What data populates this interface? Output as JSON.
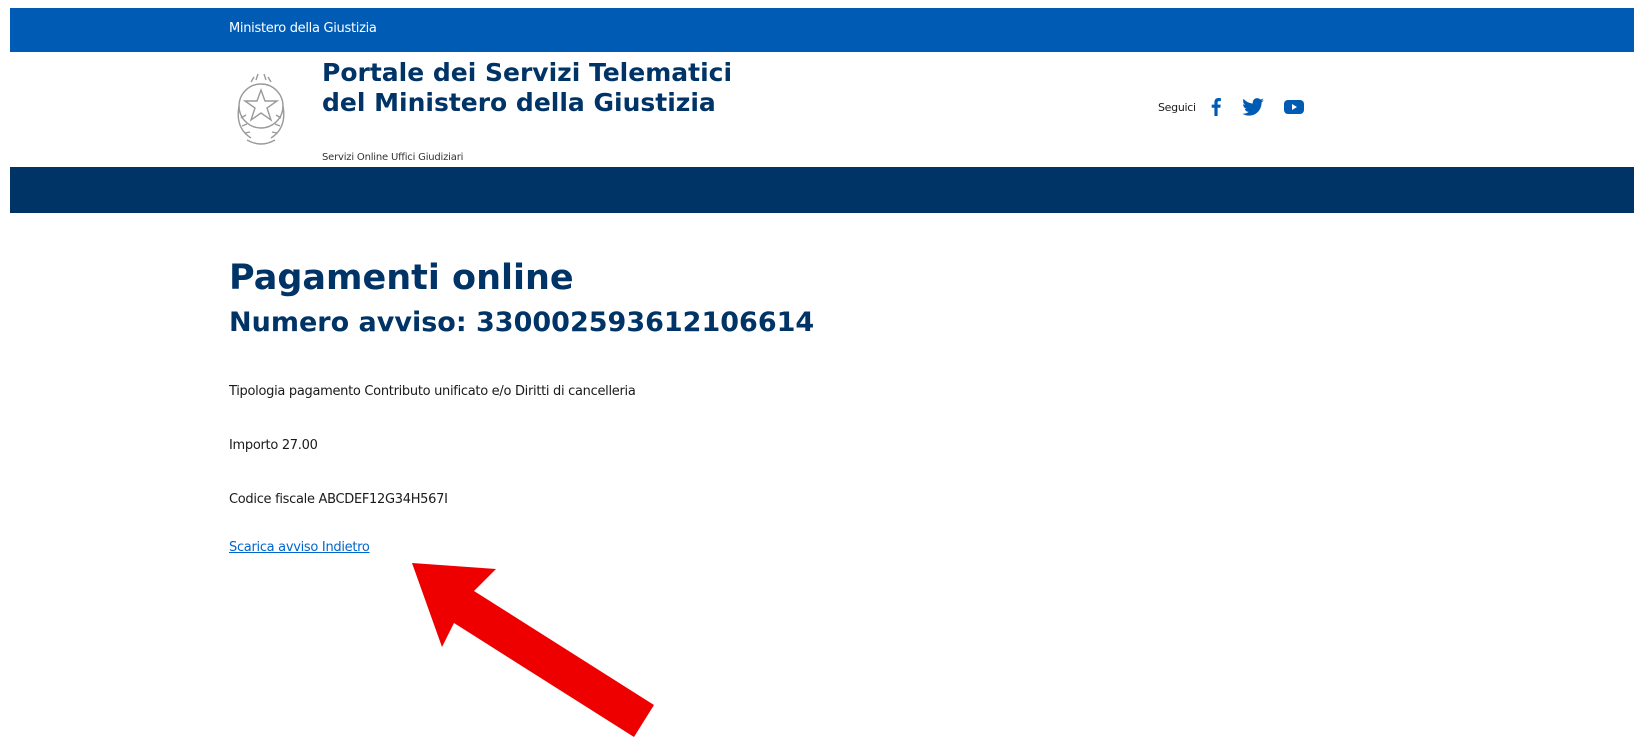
{
  "top_bar": {
    "ministry_label": "Ministero della Giustizia"
  },
  "header": {
    "portal_title": "Portale dei Servizi Telematici del Ministero della Giustizia",
    "portal_subtitle": "Servizi Online Uffici Giudiziari",
    "follow_label": "Seguici",
    "social_icons": [
      "facebook-icon",
      "twitter-icon",
      "youtube-icon"
    ]
  },
  "main": {
    "page_title": "Pagamenti online",
    "notice_heading": "Numero avviso: 330002593612106614",
    "payment_type": "Tipologia pagamento Contributo unificato e/o Diritti di cancelleria",
    "amount": "Importo 27.00",
    "tax_code": "Codice fiscale ABCDEF12G34H567I",
    "download_link": "Scarica avviso",
    "back_link": "Indietro"
  },
  "annotation": {
    "icon": "red-arrow-icon",
    "color": "#ee0000"
  },
  "colors": {
    "top_bar": "#005bb5",
    "nav_bar": "#003366",
    "heading": "#003366",
    "link": "#0066cc"
  }
}
